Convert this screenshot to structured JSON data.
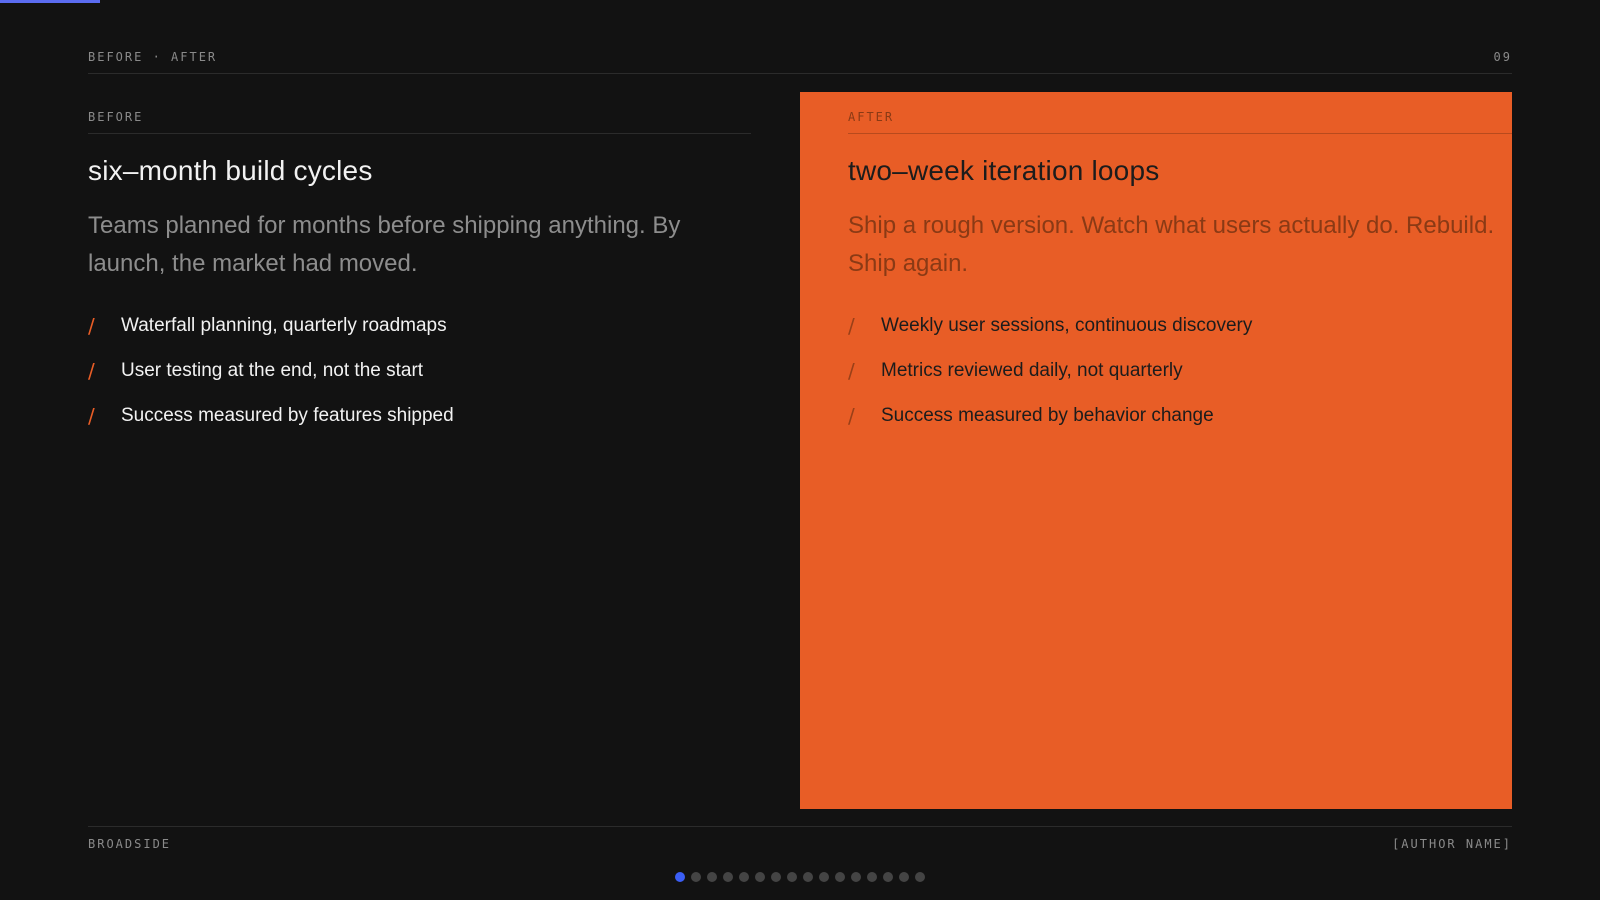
{
  "progress": {
    "fraction": 0.0625,
    "color": "#5b6cf0"
  },
  "header": {
    "section_label": "BEFORE · AFTER",
    "slide_number": "09"
  },
  "before": {
    "label": "BEFORE",
    "title": "six–month build cycles",
    "description": "Teams planned for months before shipping anything. By launch, the market had moved.",
    "bullets": [
      "Waterfall planning, quarterly roadmaps",
      "User testing at the end, not the start",
      "Success measured by features shipped"
    ]
  },
  "after": {
    "label": "AFTER",
    "title": "two–week iteration loops",
    "description": "Ship a rough version. Watch what users actually do. Rebuild. Ship again.",
    "bullets": [
      "Weekly user sessions, continuous discovery",
      "Metrics reviewed daily, not quarterly",
      "Success measured by behavior change"
    ],
    "accent_color": "#e85d26"
  },
  "bullet_marker": "/",
  "footer": {
    "brand": "BROADSIDE",
    "author": "[AUTHOR NAME]"
  },
  "pagination": {
    "total": 16,
    "current": 1
  }
}
